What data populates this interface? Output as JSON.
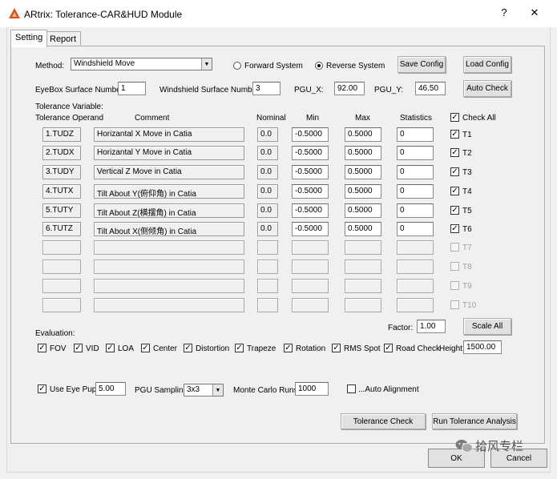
{
  "window": {
    "title": "ARtrix: Tolerance-CAR&HUD Module",
    "help_label": "?",
    "close_label": "✕"
  },
  "tabs": [
    {
      "label": "Setting",
      "active": true
    },
    {
      "label": "Report",
      "active": false
    }
  ],
  "method": {
    "label": "Method:",
    "value": "Windshield Move",
    "radio_forward": "Forward System",
    "radio_reverse": "Reverse System",
    "selected": "Reverse System"
  },
  "buttons": {
    "save_config": "Save Config",
    "load_config": "Load Config",
    "auto_check": "Auto Check",
    "scale_all": "Scale All",
    "tolerance_check": "Tolerance Check",
    "run_analysis": "Run Tolerance Analysis",
    "ok": "OK",
    "cancel": "Cancel"
  },
  "surfaces": {
    "eyebox_label": "EyeBox Surface Number:",
    "eyebox_value": "1",
    "windshield_label": "Windshield Surface Number:",
    "windshield_value": "3",
    "pgu_x_label": "PGU_X:",
    "pgu_x_value": "92.00",
    "pgu_y_label": "PGU_Y:",
    "pgu_y_value": "46.50"
  },
  "tolerance": {
    "section_label": "Tolerance  Variable:",
    "headers": {
      "operand": "Tolerance Operand",
      "comment": "Comment",
      "nominal": "Nominal",
      "min": "Min",
      "max": "Max",
      "statistics": "Statistics",
      "check_all": "Check All"
    },
    "rows": [
      {
        "operand": "1.TUDZ",
        "comment": "Horizantal X Move in Catia",
        "nominal": "0.0",
        "min": "-0.5000",
        "max": "0.5000",
        "stat": "0",
        "check": "T1",
        "checked": true
      },
      {
        "operand": "2.TUDX",
        "comment": "Horizantal Y Move in Catia",
        "nominal": "0.0",
        "min": "-0.5000",
        "max": "0.5000",
        "stat": "0",
        "check": "T2",
        "checked": true
      },
      {
        "operand": "3.TUDY",
        "comment": "Vertical Z Move in Catia",
        "nominal": "0.0",
        "min": "-0.5000",
        "max": "0.5000",
        "stat": "0",
        "check": "T3",
        "checked": true
      },
      {
        "operand": "4.TUTX",
        "comment": "Tilt About Y(俯仰角) in Catia",
        "nominal": "0.0",
        "min": "-0.5000",
        "max": "0.5000",
        "stat": "0",
        "check": "T4",
        "checked": true
      },
      {
        "operand": "5.TUTY",
        "comment": "Tilt About Z(横摆角) in Catia",
        "nominal": "0.0",
        "min": "-0.5000",
        "max": "0.5000",
        "stat": "0",
        "check": "T5",
        "checked": true
      },
      {
        "operand": "6.TUTZ",
        "comment": "Tilt About X(侧倾角) in Catia",
        "nominal": "0.0",
        "min": "-0.5000",
        "max": "0.5000",
        "stat": "0",
        "check": "T6",
        "checked": true
      }
    ],
    "disabled_checks": [
      "T7",
      "T8",
      "T9",
      "T10"
    ]
  },
  "evaluation": {
    "label": "Evaluation:",
    "factor_label": "Factor:",
    "factor_value": "1.00",
    "items": [
      {
        "label": "FOV",
        "checked": true
      },
      {
        "label": "VID",
        "checked": true
      },
      {
        "label": "LOA",
        "checked": true
      },
      {
        "label": "Center",
        "checked": true
      },
      {
        "label": "Distortion",
        "checked": true
      },
      {
        "label": "Trapeze",
        "checked": true
      },
      {
        "label": "Rotation",
        "checked": true
      },
      {
        "label": "RMS Spot",
        "checked": true
      },
      {
        "label": "Road Check",
        "checked": true
      }
    ],
    "height_label": "Height:",
    "height_value": "1500.00"
  },
  "options": {
    "eye_pupil_label": "Use Eye Pupil:",
    "eye_pupil_value": "5.00",
    "pgu_sampling_label": "PGU Sampling:",
    "pgu_sampling_value": "3x3",
    "monte_carlo_label": "Monte Carlo Runs:",
    "monte_carlo_value": "1000",
    "auto_alignment_label": "...Auto Alignment"
  },
  "watermark": "拾风专栏",
  "colors": {
    "accent_icon": "#d9541e",
    "window_bg": "#f0f0f0"
  }
}
